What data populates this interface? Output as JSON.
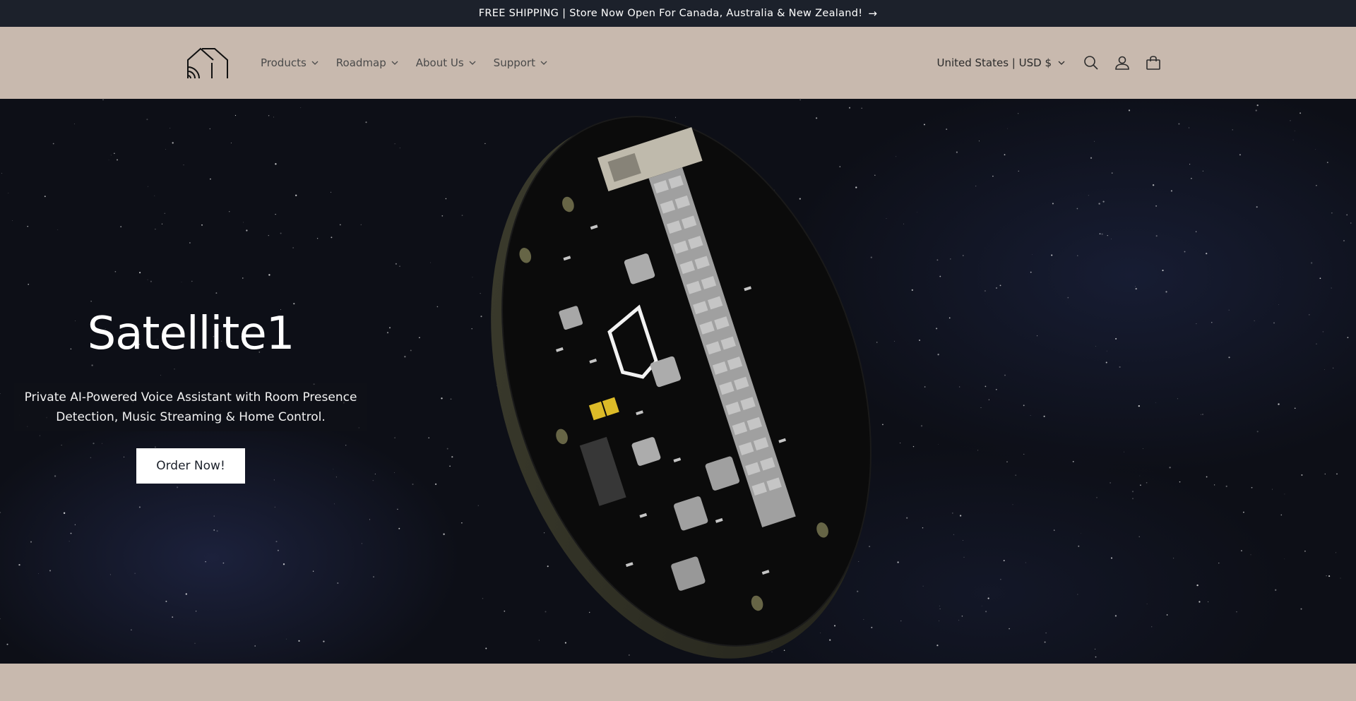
{
  "announcement": {
    "text": "FREE SHIPPING | Store Now Open For Canada, Australia & New Zealand!",
    "arrow": "→"
  },
  "header": {
    "logo_icon": "house-signal-logo",
    "nav": [
      {
        "label": "Products"
      },
      {
        "label": "Roadmap"
      },
      {
        "label": "About Us"
      },
      {
        "label": "Support"
      }
    ],
    "locale": "United States | USD $",
    "icons": [
      "search-icon",
      "account-icon",
      "cart-icon"
    ]
  },
  "hero": {
    "title": "Satellite1",
    "subtitle": "Private AI-Powered Voice Assistant with Room Presence Detection, Music Streaming & Home Control.",
    "cta": "Order Now!"
  },
  "colors": {
    "announcement_bg": "#1c212b",
    "header_bg": "#c8b9ae",
    "hero_bg": "#0d0f17",
    "cta_bg": "#ffffff"
  }
}
